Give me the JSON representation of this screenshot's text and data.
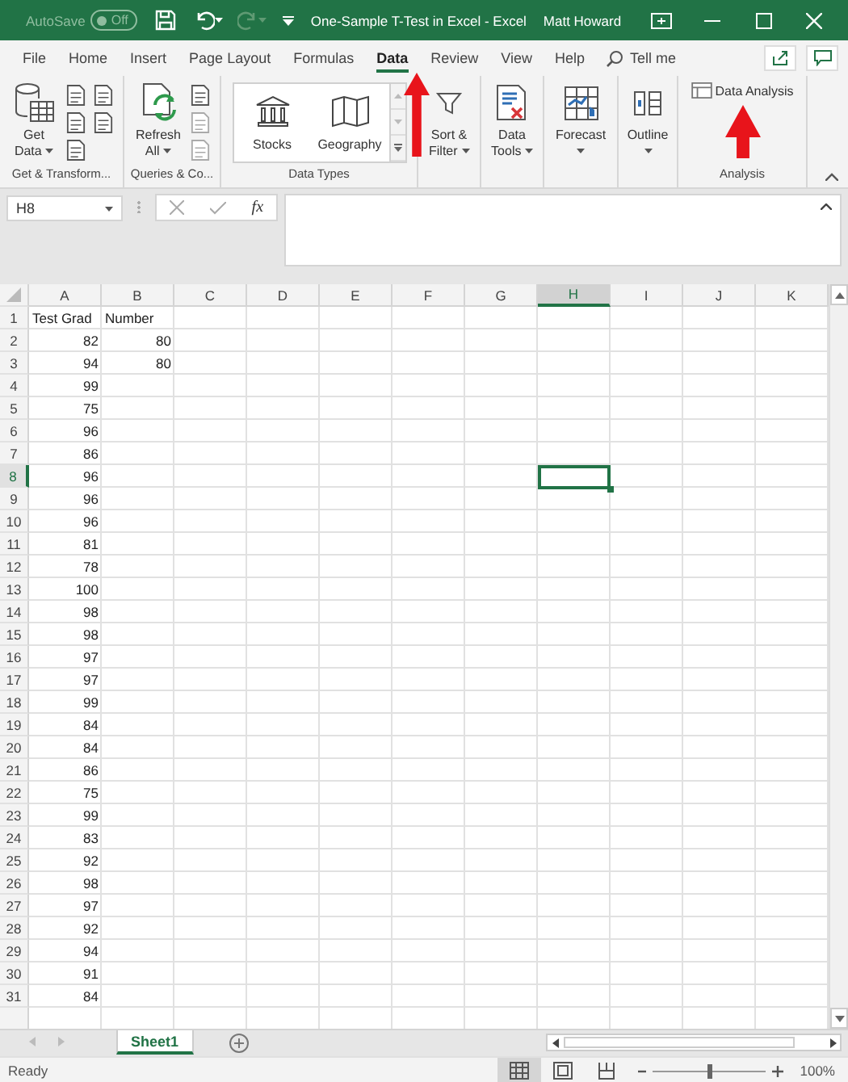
{
  "title_bar": {
    "autosave": {
      "label": "AutoSave",
      "on": false,
      "state_text": "Off"
    },
    "redo_disabled": true,
    "title": "One-Sample T-Test in Excel  -  Excel",
    "user": "Matt Howard"
  },
  "ribbon_tabs": [
    {
      "label": "File",
      "selected": false
    },
    {
      "label": "Home",
      "selected": false
    },
    {
      "label": "Insert",
      "selected": false
    },
    {
      "label": "Page Layout",
      "selected": false
    },
    {
      "label": "Formulas",
      "selected": false
    },
    {
      "label": "Data",
      "selected": true
    },
    {
      "label": "Review",
      "selected": false
    },
    {
      "label": "View",
      "selected": false
    },
    {
      "label": "Help",
      "selected": false
    }
  ],
  "tell_me": "Tell me",
  "ribbon_groups": [
    {
      "label": "Get & Transform...",
      "buttons": [
        {
          "kind": "large",
          "label": "Get Data",
          "dropdown": true
        },
        {
          "kind": "icon_column"
        },
        {
          "kind": "icon_column"
        }
      ]
    },
    {
      "label": "Queries & Co...",
      "buttons": [
        {
          "kind": "large",
          "label": "Refresh All",
          "dropdown": true
        },
        {
          "kind": "icon_column"
        }
      ]
    },
    {
      "label": "Data Types",
      "buttons": [
        {
          "kind": "gallery",
          "items": [
            "Stocks",
            "Geography"
          ]
        }
      ]
    },
    {
      "buttons": [
        {
          "kind": "large",
          "label": "Sort & Filter",
          "dropdown": true
        }
      ]
    },
    {
      "buttons": [
        {
          "kind": "large",
          "label": "Data Tools",
          "dropdown": true
        }
      ]
    },
    {
      "buttons": [
        {
          "kind": "large",
          "label": "Forecast",
          "dropdown": true
        }
      ]
    },
    {
      "buttons": [
        {
          "kind": "large",
          "label": "Outline",
          "dropdown": true
        }
      ]
    },
    {
      "label": "Analysis",
      "buttons": [
        {
          "kind": "small",
          "label": "Data Analysis"
        }
      ]
    }
  ],
  "formula_bar": {
    "name_box": "H8",
    "function_button": "fx"
  },
  "grid": {
    "columns": [
      {
        "label": "A",
        "selected": false
      },
      {
        "label": "B",
        "selected": false
      },
      {
        "label": "C",
        "selected": false
      },
      {
        "label": "D",
        "selected": false
      },
      {
        "label": "E",
        "selected": false
      },
      {
        "label": "F",
        "selected": false
      },
      {
        "label": "G",
        "selected": false
      },
      {
        "label": "H",
        "selected": true
      },
      {
        "label": "I",
        "selected": false
      },
      {
        "label": "J",
        "selected": false
      },
      {
        "label": "K",
        "selected": false
      }
    ],
    "rows": [
      {
        "number": "1",
        "selected": false,
        "cells": [
          "Test Grad",
          "Number"
        ]
      },
      {
        "number": "2",
        "selected": false,
        "cells": [
          "82",
          "80"
        ]
      },
      {
        "number": "3",
        "selected": false,
        "cells": [
          "94",
          "80"
        ]
      },
      {
        "number": "4",
        "selected": false,
        "cells": [
          "99"
        ]
      },
      {
        "number": "5",
        "selected": false,
        "cells": [
          "75"
        ]
      },
      {
        "number": "6",
        "selected": false,
        "cells": [
          "96"
        ]
      },
      {
        "number": "7",
        "selected": false,
        "cells": [
          "86"
        ]
      },
      {
        "number": "8",
        "selected": true,
        "cells": [
          "96"
        ]
      },
      {
        "number": "9",
        "selected": false,
        "cells": [
          "96"
        ]
      },
      {
        "number": "10",
        "selected": false,
        "cells": [
          "96"
        ]
      },
      {
        "number": "11",
        "selected": false,
        "cells": [
          "81"
        ]
      },
      {
        "number": "12",
        "selected": false,
        "cells": [
          "78"
        ]
      },
      {
        "number": "13",
        "selected": false,
        "cells": [
          "100"
        ]
      },
      {
        "number": "14",
        "selected": false,
        "cells": [
          "98"
        ]
      },
      {
        "number": "15",
        "selected": false,
        "cells": [
          "98"
        ]
      },
      {
        "number": "16",
        "selected": false,
        "cells": [
          "97"
        ]
      },
      {
        "number": "17",
        "selected": false,
        "cells": [
          "97"
        ]
      },
      {
        "number": "18",
        "selected": false,
        "cells": [
          "99"
        ]
      },
      {
        "number": "19",
        "selected": false,
        "cells": [
          "84"
        ]
      },
      {
        "number": "20",
        "selected": false,
        "cells": [
          "84"
        ]
      },
      {
        "number": "21",
        "selected": false,
        "cells": [
          "86"
        ]
      },
      {
        "number": "22",
        "selected": false,
        "cells": [
          "75"
        ]
      },
      {
        "number": "23",
        "selected": false,
        "cells": [
          "99"
        ]
      },
      {
        "number": "24",
        "selected": false,
        "cells": [
          "83"
        ]
      },
      {
        "number": "25",
        "selected": false,
        "cells": [
          "92"
        ]
      },
      {
        "number": "26",
        "selected": false,
        "cells": [
          "98"
        ]
      },
      {
        "number": "27",
        "selected": false,
        "cells": [
          "97"
        ]
      },
      {
        "number": "28",
        "selected": false,
        "cells": [
          "92"
        ]
      },
      {
        "number": "29",
        "selected": false,
        "cells": [
          "94"
        ]
      },
      {
        "number": "30",
        "selected": false,
        "cells": [
          "91"
        ]
      },
      {
        "number": "31",
        "selected": false,
        "cells": [
          "84"
        ]
      }
    ]
  },
  "sheet_tabs": [
    {
      "label": "Sheet1",
      "selected": true
    }
  ],
  "status_bar": {
    "status": "Ready",
    "views": [
      {
        "kind": "normal",
        "selected": true
      },
      {
        "kind": "page_layout",
        "selected": false
      },
      {
        "kind": "page_break",
        "selected": false
      }
    ],
    "zoom": {
      "level": 0.5,
      "reading": "100%"
    }
  },
  "annotations": [
    {
      "kind": "arrow"
    },
    {
      "kind": "arrow"
    }
  ]
}
